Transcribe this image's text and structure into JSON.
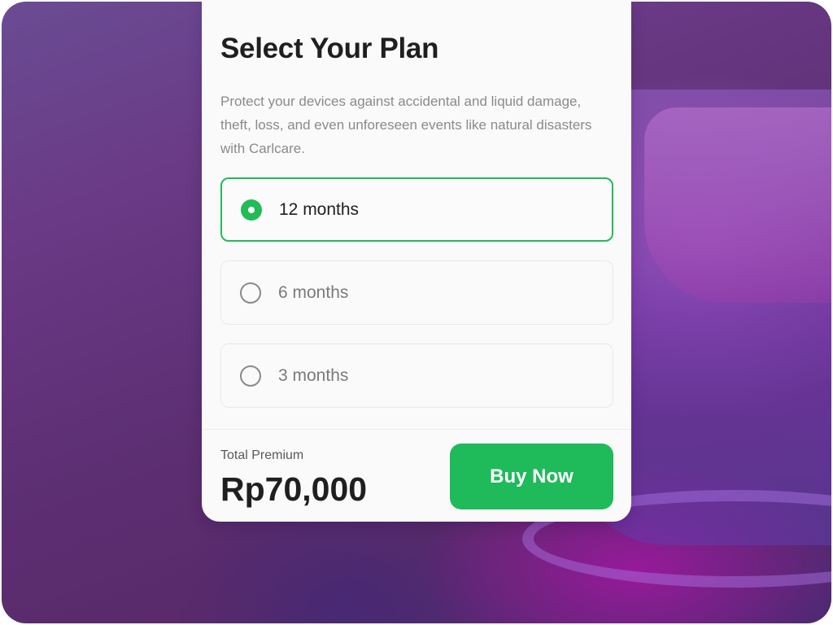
{
  "plan": {
    "title": "Select Your Plan",
    "description": "Protect your devices against accidental and liquid damage, theft, loss, and even unforeseen events like natural disasters with Carlcare.",
    "options": [
      {
        "label": "12 months",
        "selected": true
      },
      {
        "label": "6 months",
        "selected": false
      },
      {
        "label": "3 months",
        "selected": false
      }
    ]
  },
  "footer": {
    "total_label": "Total Premium",
    "total_value": "Rp70,000",
    "buy_label": "Buy Now"
  },
  "colors": {
    "accent": "#1fba5a",
    "background": "#5c2e72"
  }
}
